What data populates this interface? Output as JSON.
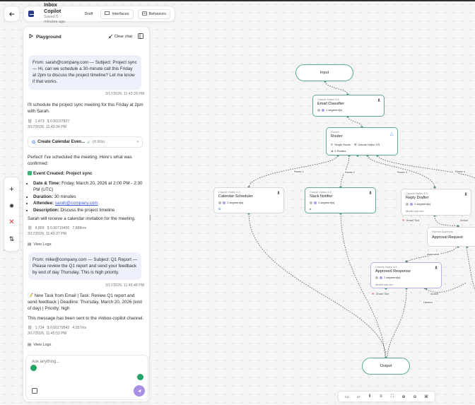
{
  "header": {
    "back_icon": "arrow-left-icon",
    "app_title": "Inbox Copilot",
    "saved_text": "Saved 5 minutes ago",
    "status_badge": "Draft",
    "interfaces_label": "Interfaces",
    "behaviors_label": "Behaviors"
  },
  "playground": {
    "title": "Playground",
    "clear_chat": "Clear chat",
    "messages": [
      {
        "text": "From: sarah@company.com — Subject: Project sync — Hi, can we schedule a 30-minute call this Friday at 2pm to discuss the project timeline? Let me know if that works.",
        "timestamp": "3/17/2026, 11:43:29 PM"
      },
      {
        "text": "I'll schedule the project sync meeting for this Friday at 2pm with Sarah.",
        "tokens": "1,473",
        "cost": "$ 0.00237827",
        "timestamp": "3/17/2026, 11:43:34 PM"
      },
      {
        "tool_name": "Create Calendar Even...",
        "tool_time": "(0.90s)"
      },
      {
        "intro": "Perfect! I've scheduled the meeting. Here's what was confirmed:",
        "event_title": "Event Created: Project sync",
        "bullets": [
          {
            "label": "Date & Time:",
            "value": " Friday, March 20, 2026 at 2:00 PM - 2:30 PM (UTC)"
          },
          {
            "label": "Duration:",
            "value": " 30 minutes"
          },
          {
            "label": "Attendee:",
            "value": "sarah@company.com"
          },
          {
            "label": "Description:",
            "value": " Discuss the project timeline"
          }
        ],
        "outro": "Sarah will receive a calendar invitation for the meeting.",
        "tokens": "4,809",
        "cost": "$ 0.00719455",
        "duration": "7,888ms",
        "timestamp": "3/17/2026, 11:43:37 PM",
        "view_logs": "View Logs"
      },
      {
        "text": "From: mike@company.com — Subject: Q1 Report — Please review the Q1 report and send your feedback by end of day Thursday. This is high priority.",
        "timestamp": "3/17/2026, 11:45:48 PM"
      },
      {
        "task_text": "New Task from Email | Task: Review Q1 report and send feedback | Deadline: Thursday, March 20, 2026 (end of day) | Priority: high",
        "slack_text": "This message has been sent to the #inbox-copilot channel.",
        "tokens": "1,734",
        "cost": "$ 0.00279542",
        "duration": "4,057ms",
        "timestamp": "3/17/2026, 11:45:53 PM",
        "view_logs": "View Logs"
      }
    ],
    "input_placeholder": "Ask anything..."
  },
  "canvas": {
    "input_label": "Input",
    "output_label": "Output",
    "email_classifier": {
      "model": "Claude Haiku 4.5",
      "name": "Email Classifier",
      "segments": "1 segment(s)"
    },
    "router": {
      "model": "Router",
      "name": "Router",
      "single_route": "Single Route",
      "router_model": "Claude Haiku 4.5",
      "routes_count": "4 Routes"
    },
    "route_labels": [
      "Route 1",
      "Route 2",
      "Route 3",
      "Route 4"
    ],
    "calendar_scheduler": {
      "model": "Claude Haiku 4.5",
      "name": "Calendar Scheduler",
      "segments": "1 segment(s)"
    },
    "slack_notifier": {
      "model": "Claude Haiku 4.5",
      "name": "Slack Notifier",
      "segments": "1 segment(s)"
    },
    "reply_drafter": {
      "model": "Claude Haiku 4.5",
      "name": "Reply Drafter",
      "segments": "1 segment(s)",
      "model_sub": "Model sub-run",
      "gmail_tool": "Gmail Tool",
      "action": "Action"
    },
    "approval_request": {
      "model": "Human Approval",
      "name": "Approval Request"
    },
    "approved_label": "Approved",
    "denied_label": "Denied",
    "approved_response": {
      "model": "Claude Haiku 4.5",
      "name": "Approved Response",
      "segments": "1 segment(s)",
      "model_sub": "Model sub-run",
      "gmail_tool": "Gmail Tool",
      "action": "Action"
    }
  },
  "colors": {
    "accent": "#5cae8f",
    "user_bubble": "#eef0fb",
    "send_button": "#a88fe3",
    "success": "#24a366",
    "danger": "#e03131"
  }
}
